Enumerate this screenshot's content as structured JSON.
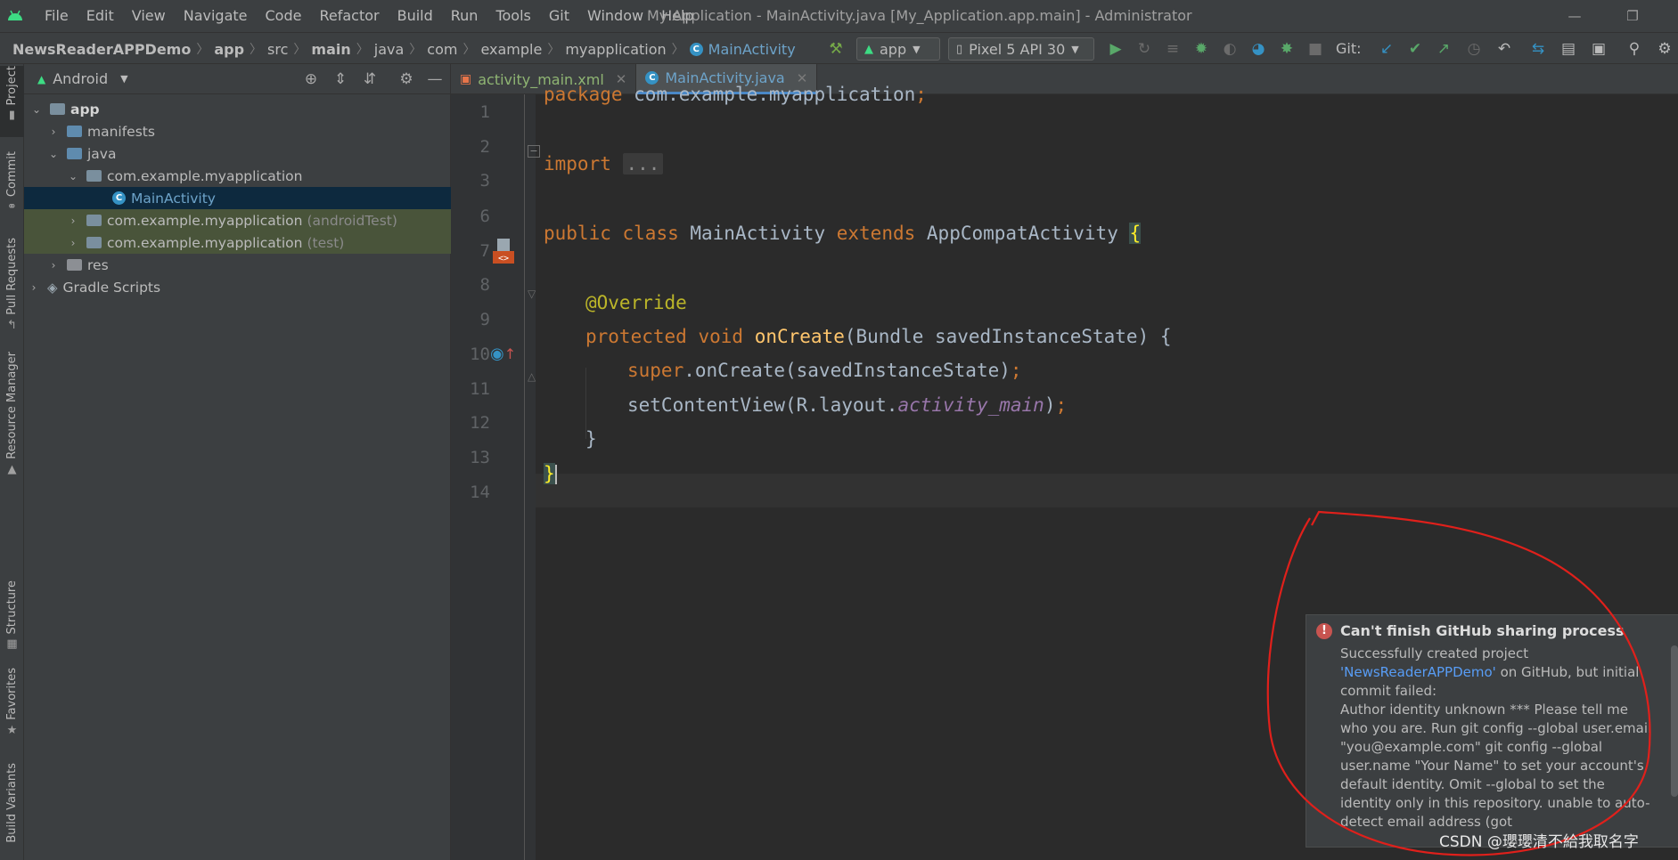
{
  "menu": [
    "File",
    "Edit",
    "View",
    "Navigate",
    "Code",
    "Refactor",
    "Build",
    "Run",
    "Tools",
    "Git",
    "Window",
    "Help"
  ],
  "window_title": "My Application - MainActivity.java [My_Application.app.main] - Administrator",
  "breadcrumb": [
    "NewsReaderAPPDemo",
    "app",
    "src",
    "main",
    "java",
    "com",
    "example",
    "myapplication",
    "MainActivity"
  ],
  "toolbar": {
    "run_config": "app",
    "device": "Pixel 5 API 30",
    "git_label": "Git:"
  },
  "left_stripe": [
    "Project",
    "Commit",
    "Pull Requests",
    "Resource Manager",
    "Structure",
    "Favorites",
    "Build Variants"
  ],
  "project": {
    "view": "Android",
    "tree": [
      {
        "label": "app",
        "hint": ""
      },
      {
        "label": "manifests",
        "hint": ""
      },
      {
        "label": "java",
        "hint": ""
      },
      {
        "label": "com.example.myapplication",
        "hint": ""
      },
      {
        "label": "MainActivity",
        "hint": ""
      },
      {
        "label": "com.example.myapplication",
        "hint": "(androidTest)"
      },
      {
        "label": "com.example.myapplication",
        "hint": "(test)"
      },
      {
        "label": "res",
        "hint": ""
      },
      {
        "label": "Gradle Scripts",
        "hint": ""
      }
    ]
  },
  "editor_tabs": [
    "activity_main.xml",
    "MainActivity.java"
  ],
  "code": {
    "line_numbers": [
      "1",
      "2",
      "3",
      "6",
      "7",
      "8",
      "9",
      "10",
      "11",
      "12",
      "13",
      "14"
    ],
    "l1": {
      "kw": "package",
      "rest": " com.example.myapplication",
      "semi": ";"
    },
    "l3": {
      "kw": "import",
      "fold": "..."
    },
    "l7": {
      "kw1": "public",
      "kw2": "class",
      "name": " MainActivity ",
      "kw3": "extends",
      "rest": " AppCompatActivity ",
      "brace": "{"
    },
    "l9": {
      "ann": "@Override"
    },
    "l10": {
      "kw1": "protected",
      "kw2": "void",
      "fn": "onCreate",
      "rest": "(Bundle savedInstanceState) {"
    },
    "l11": {
      "kw": "super",
      "rest": ".onCreate(savedInstanceState)",
      "semi": ";"
    },
    "l12": {
      "pre": "setContentView(R.layout.",
      "fld": "activity_main",
      "post": ")",
      "semi": ";"
    },
    "l13": {
      "text": "}"
    },
    "l14": {
      "brace": "}"
    }
  },
  "notification": {
    "title": "Can't finish GitHub sharing process",
    "line1": "Successfully created project",
    "link": "'NewsReaderAPPDemo'",
    "line2": " on GitHub, but initial commit failed:",
    "body": "Author identity unknown *** Please tell me who you are. Run git config --global user.email \"you@example.com\" git config --global user.name \"Your Name\" to set your account's default identity. Omit --global to set the identity only in this repository. unable to auto-detect email address (got"
  },
  "watermark": "CSDN @瓔瓔清不給我取名字",
  "colors": {
    "annotation": "#e0201b",
    "accent": "#4a88c7"
  }
}
